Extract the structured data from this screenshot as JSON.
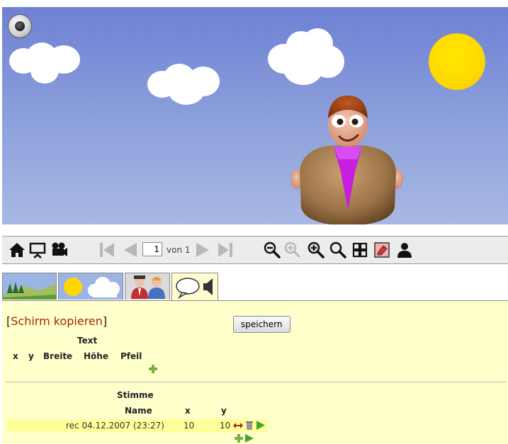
{
  "scene": {
    "sound_icon": "record-button-icon",
    "sun_icon": "sun",
    "character": "cartoon-man-brown-jacket-purple-tie",
    "colors": {
      "sky_top": "#6e80d4",
      "sky_bottom": "#a8b8e4",
      "sun": "#ffd800"
    }
  },
  "toolbar": {
    "icons": [
      "home-icon",
      "presentation-icon",
      "movie-camera-icon",
      "first-page-icon",
      "prev-page-icon",
      "next-page-icon",
      "last-page-icon",
      "zoom-out-icon",
      "zoom-fit-icon",
      "zoom-in-icon",
      "zoom-actual-icon",
      "grid-icon",
      "erase-icon",
      "user-icon"
    ],
    "page_value": "1",
    "page_of": "von 1"
  },
  "tabs": [
    {
      "icon": "landscape-tab-icon"
    },
    {
      "icon": "sun-cloud-tab-icon"
    },
    {
      "icon": "characters-tab-icon"
    },
    {
      "icon": "speech-sound-tab-icon",
      "active": true
    }
  ],
  "panel": {
    "copy_bracket_open": "[",
    "copy_label": "Schirm kopieren",
    "copy_bracket_close": "]",
    "save_label": "speichern",
    "text_section": {
      "title": "Text",
      "columns": [
        "x",
        "y",
        "Breite",
        "Höhe",
        "Pfeil"
      ]
    },
    "voice_section": {
      "title": "Stimme",
      "columns": [
        "Name",
        "x",
        "y"
      ],
      "rows": [
        {
          "name": "rec 04.12.2007 (23:27)",
          "x": "10",
          "y": "10"
        }
      ]
    },
    "colors": {
      "panel_bg": "#ffffcc",
      "row_highlight": "#ffff99",
      "link": "#a52a00"
    }
  }
}
